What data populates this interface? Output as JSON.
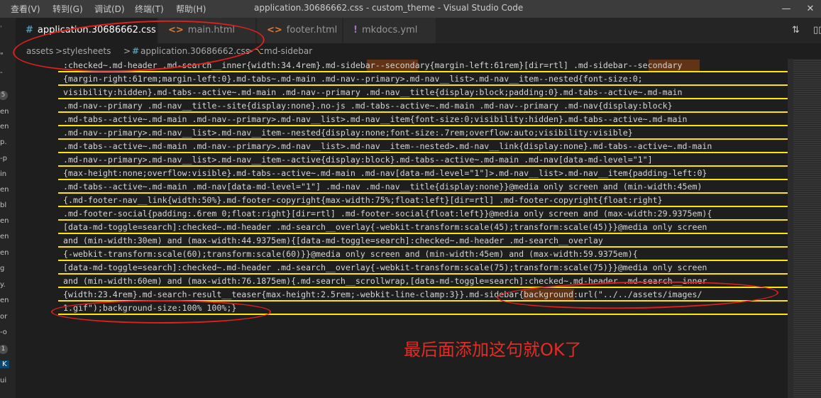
{
  "menu": [
    "查看(V)",
    "转到(G)",
    "调试(D)",
    "终端(T)",
    "帮助(H)"
  ],
  "window_title": "application.30686662.css - custom_theme - Visual Studio Code",
  "window_controls": {
    "minimize": "—",
    "close": "✕"
  },
  "tabs": [
    {
      "icon": "#",
      "label": "application.30686662.css",
      "close": "✕",
      "active": true
    },
    {
      "icon": "<>",
      "label": "main.html"
    },
    {
      "icon": "<>",
      "label": "footer.html"
    },
    {
      "icon": "!",
      "label": "mkdocs.yml"
    }
  ],
  "breadcrumb": [
    "assets",
    "stylesheets",
    "application.30686662.css",
    "md-sidebar"
  ],
  "breadcrumb_sep": ">",
  "sidebar_items": [
    "'",
    "\"",
    "-",
    "5",
    "en",
    "en",
    "p.",
    "-p",
    "in",
    "en",
    "bl",
    "en",
    "en",
    "en",
    "g",
    "y.",
    "en",
    "or",
    "-o",
    "1",
    "K",
    "ui"
  ],
  "code_lines": [
    ":checked~.md-header .md-search__inner{width:34.4rem}.md-sidebar--secondary{margin-left:61rem}[dir=rtl] .md-sidebar--secondary",
    "{margin-right:61rem;margin-left:0}.md-tabs~.md-main .md-nav--primary>.md-nav__list>.md-nav__item--nested{font-size:0;",
    "visibility:hidden}.md-tabs--active~.md-main .md-nav--primary .md-nav__title{display:block;padding:0}.md-tabs--active~.md-main",
    ".md-nav--primary .md-nav__title--site{display:none}.no-js .md-tabs--active~.md-main .md-nav--primary .md-nav{display:block}",
    ".md-tabs--active~.md-main .md-nav--primary>.md-nav__list>.md-nav__item{font-size:0;visibility:hidden}.md-tabs--active~.md-main",
    ".md-nav--primary>.md-nav__list>.md-nav__item--nested{display:none;font-size:.7rem;overflow:auto;visibility:visible}",
    ".md-tabs--active~.md-main .md-nav--primary>.md-nav__list>.md-nav__item--nested>.md-nav__link{display:none}.md-tabs--active~.md-main",
    ".md-nav--primary>.md-nav__list>.md-nav__item--active{display:block}.md-tabs--active~.md-main .md-nav[data-md-level=\"1\"]",
    "{max-height:none;overflow:visible}.md-tabs--active~.md-main .md-nav[data-md-level=\"1\"]>.md-nav__list>.md-nav__item{padding-left:0}",
    ".md-tabs--active~.md-main .md-nav[data-md-level=\"1\"] .md-nav .md-nav__title{display:none}}@media only screen and (min-width:45em)",
    "{.md-footer-nav__link{width:50%}.md-footer-copyright{max-width:75%;float:left}[dir=rtl] .md-footer-copyright{float:right}",
    ".md-footer-social{padding:.6rem 0;float:right}[dir=rtl] .md-footer-social{float:left}}@media only screen and (max-width:29.9375em){",
    "[data-md-toggle=search]:checked~.md-header .md-search__overlay{-webkit-transform:scale(45);transform:scale(45)}}@media only screen",
    "and (min-width:30em) and (max-width:44.9375em){[data-md-toggle=search]:checked~.md-header .md-search__overlay",
    "{-webkit-transform:scale(60);transform:scale(60)}}@media only screen and (min-width:45em) and (max-width:59.9375em){",
    "[data-md-toggle=search]:checked~.md-header .md-search__overlay{-webkit-transform:scale(75);transform:scale(75)}}@media only screen",
    "and (min-width:60em) and (max-width:76.1875em){.md-search__scrollwrap,[data-md-toggle=search]:checked~.md-header .md-search__inner",
    "{width:23.4rem}.md-search-result__teaser{max-height:2.5rem;-webkit-line-clamp:3}}.md-sidebar{background:url(\"../../assets/images/",
    "1.gif\");background-size:100% 100%;}"
  ],
  "annotation": "最后面添加这句就OK了",
  "colors": {
    "underline": "#ffe600",
    "annotation": "#e52b23",
    "highlight": "#623315"
  }
}
